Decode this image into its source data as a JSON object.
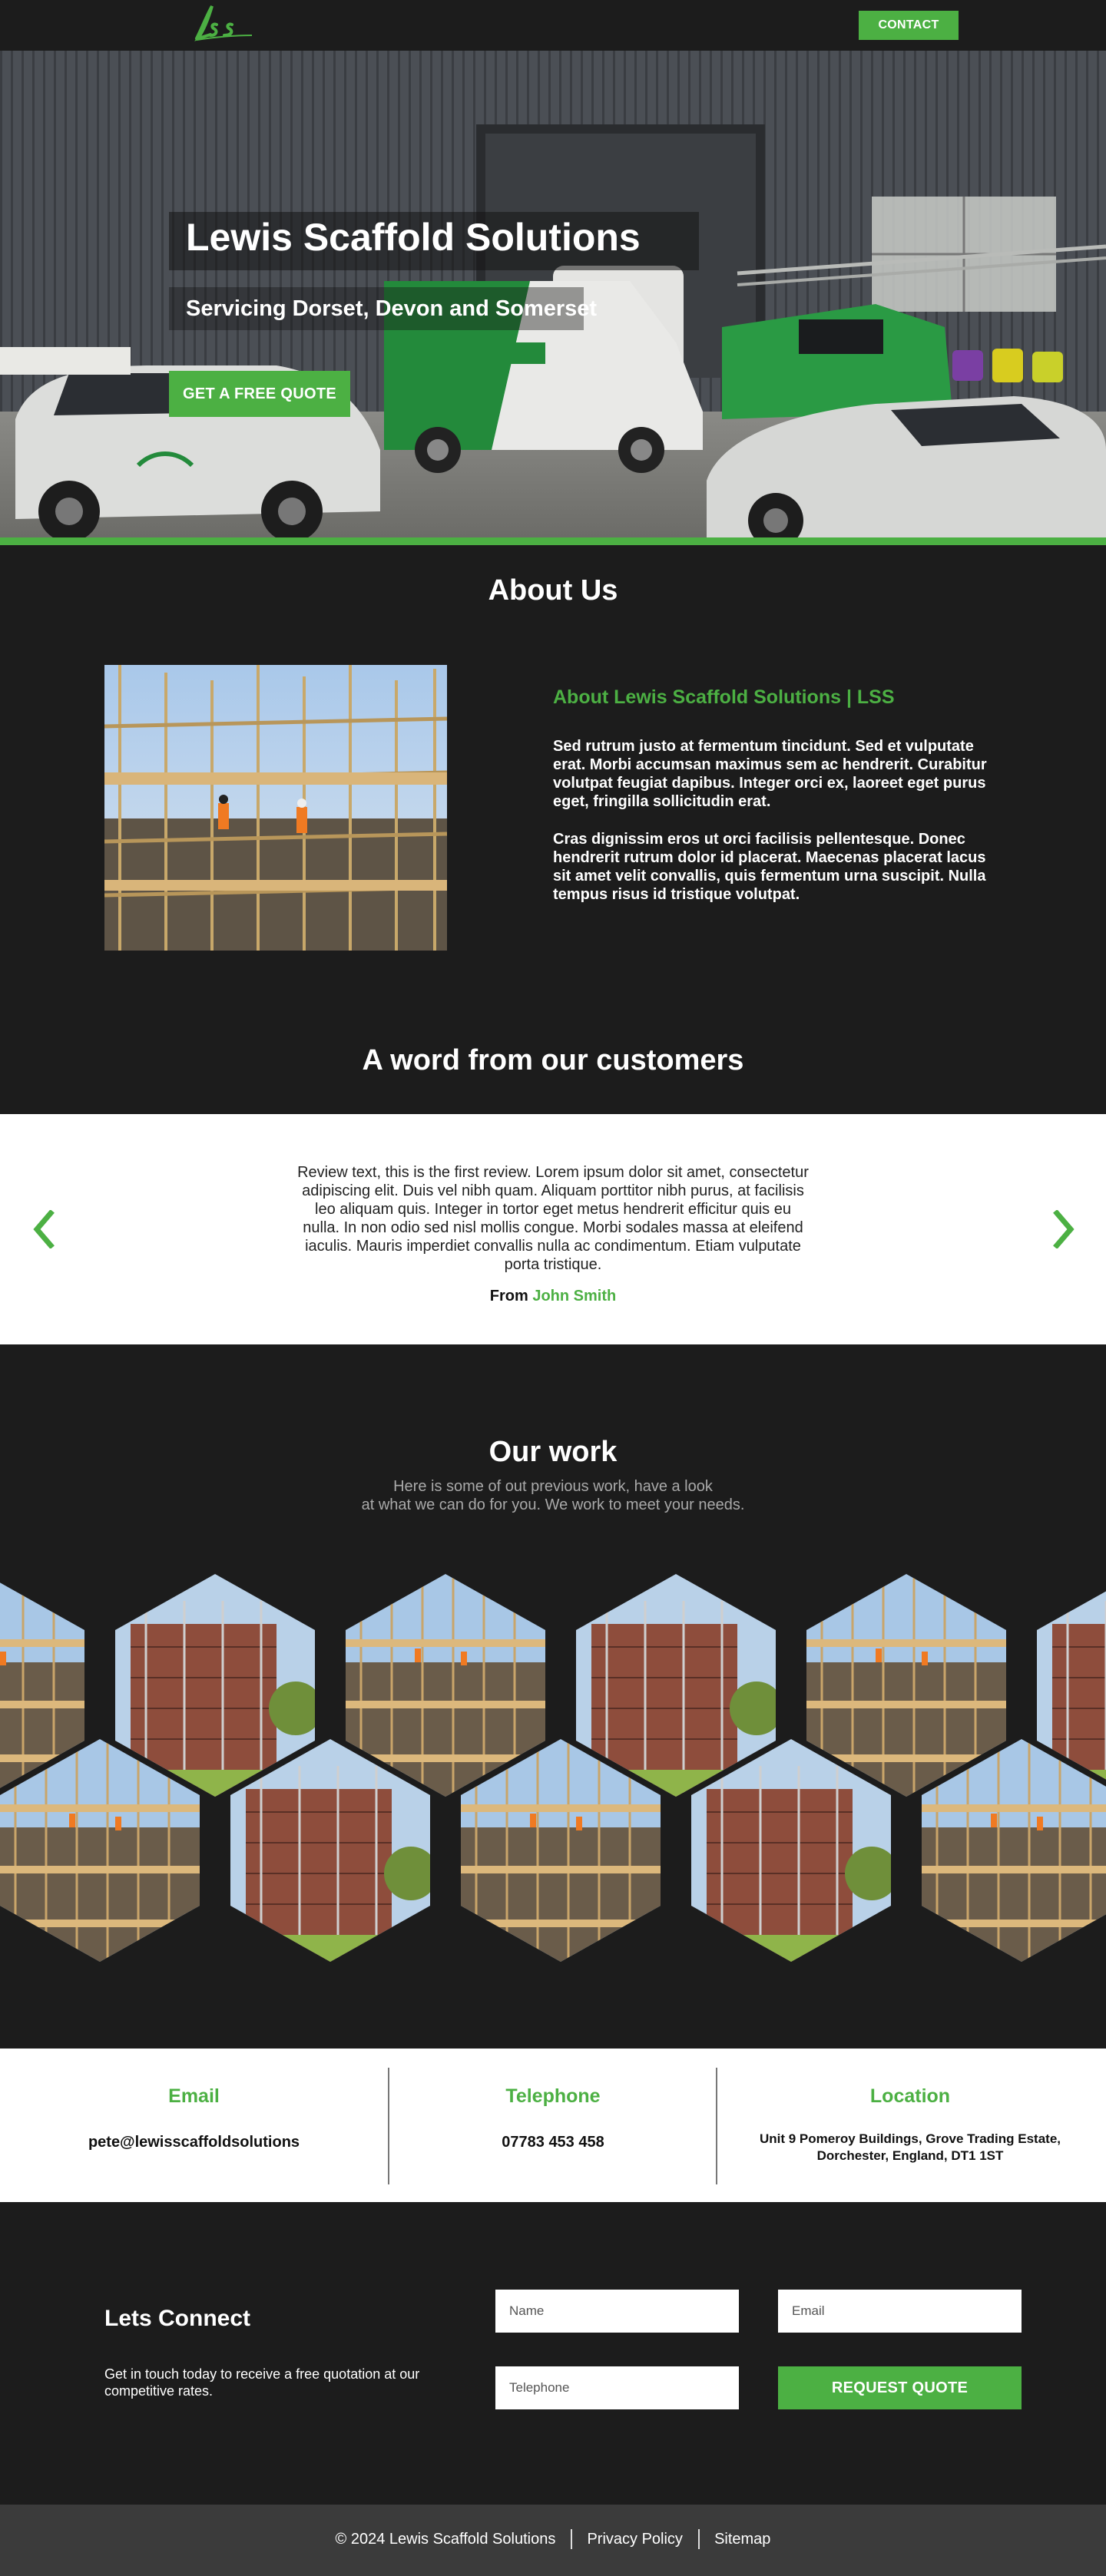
{
  "header": {
    "cta": "CONTACT"
  },
  "hero": {
    "title": "Lewis Scaffold Solutions",
    "subtitle": "Servicing Dorset, Devon and Somerset",
    "cta": "GET A FREE QUOTE"
  },
  "about": {
    "heading": "About Us",
    "subheading": "About Lewis Scaffold Solutions | LSS",
    "paragraphs": [
      "Sed rutrum justo at fermentum tincidunt. Sed et vulputate erat. Morbi accumsan maximus sem ac hendrerit. Curabitur volutpat feugiat dapibus. Integer orci ex, laoreet eget purus eget, fringilla sollicitudin erat.",
      "Cras dignissim eros ut orci facilisis pellentesque. Donec hendrerit rutrum dolor id placerat. Maecenas placerat lacus sit amet velit convallis, quis fermentum urna suscipit. Nulla tempus risus id tristique volutpat."
    ]
  },
  "reviews": {
    "heading": "A word from our customers",
    "text": "Review text, this is the first review. Lorem ipsum dolor sit amet, consectetur adipiscing elit. Duis vel nibh quam. Aliquam porttitor nibh purus, at facilisis leo aliquam quis. Integer in tortor eget metus hendrerit efficitur quis eu nulla. In non odio sed nisl mollis congue. Morbi sodales massa at eleifend iaculis. Mauris imperdiet convallis nulla ac condimentum. Etiam vulputate porta tristique.",
    "from_label": "From",
    "author": "John Smith"
  },
  "work": {
    "heading": "Our work",
    "subtitle_line1": "Here is some of out previous work, have a look",
    "subtitle_line2": "at what we can do for you. We work to meet your needs."
  },
  "contact": {
    "email_label": "Email",
    "email_value": "pete@lewisscaffoldsolutions",
    "phone_label": "Telephone",
    "phone_value": "07783 453 458",
    "location_label": "Location",
    "location_line1": "Unit 9 Pomeroy Buildings, Grove Trading Estate,",
    "location_line2": "Dorchester, England, DT1 1ST"
  },
  "form": {
    "heading": "Lets Connect",
    "text": "Get in touch today to receive a free quotation at our competitive rates.",
    "name_placeholder": "Name",
    "email_placeholder": "Email",
    "phone_placeholder": "Telephone",
    "submit": "REQUEST QUOTE"
  },
  "footer": {
    "copyright": "© 2024 Lewis Scaffold Solutions",
    "privacy": "Privacy Policy",
    "sitemap": "Sitemap"
  },
  "colors": {
    "accent": "#4cb043",
    "dark": "#1c1c1c",
    "footer": "#3b3b3b"
  },
  "icons": {
    "prev": "chevron-left-icon",
    "next": "chevron-right-icon",
    "logo": "lss-logo-icon"
  }
}
